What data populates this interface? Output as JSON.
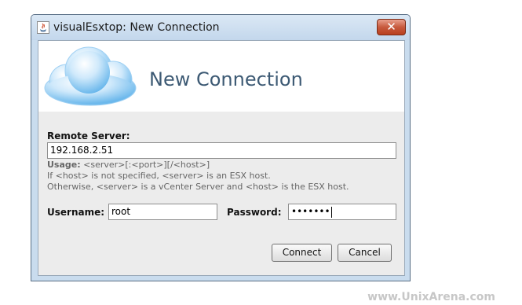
{
  "window": {
    "title": "visualEsxtop: New Connection",
    "close_symbol": "✕"
  },
  "banner": {
    "title": "New Connection",
    "image": "cloud-icon"
  },
  "form": {
    "remote_server_label": "Remote Server:",
    "remote_server_value": "192.168.2.51",
    "usage_label": "Usage:",
    "usage_text": " <server>[:<port>][/<host>]",
    "hint_line1": "If <host> is not specified, <server> is an ESX host.",
    "hint_line2": "Otherwise, <server> is a vCenter Server and <host> is the ESX host.",
    "username_label": "Username:",
    "username_value": "root",
    "password_label": "Password:",
    "password_value": "•••••••"
  },
  "buttons": {
    "connect": "Connect",
    "cancel": "Cancel"
  },
  "watermark": "www.UnixArena.com",
  "colors": {
    "titlebar": "#c9dcee",
    "close_button": "#c75a3e",
    "banner_title": "#3d5a74",
    "cloud": "#7fc3f0"
  }
}
